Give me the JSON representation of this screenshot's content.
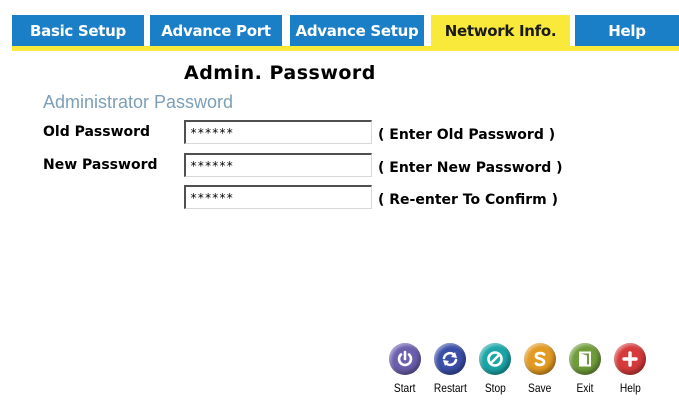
{
  "tabs": [
    {
      "label": "Basic Setup"
    },
    {
      "label": "Advance Port"
    },
    {
      "label": "Advance Setup"
    },
    {
      "label": "Network Info."
    },
    {
      "label": "Help"
    }
  ],
  "active_tab": "Network Info.",
  "page": {
    "title": "Admin. Password",
    "section_title": "Administrator Password"
  },
  "form": {
    "old_password": {
      "label": "Old Password",
      "value": "******",
      "hint": "( Enter Old Password )"
    },
    "new_password": {
      "label": "New Password",
      "value": "******",
      "hint": "( Enter New Password )"
    },
    "confirm_password": {
      "value": "******",
      "hint": "( Re-enter To Confirm )"
    }
  },
  "actions": [
    {
      "label": "Start",
      "icon": "power-icon",
      "color": "#6b5fae"
    },
    {
      "label": "Restart",
      "icon": "restart-icon",
      "color": "#3b4fa8"
    },
    {
      "label": "Stop",
      "icon": "stop-icon",
      "color": "#1aa5a8"
    },
    {
      "label": "Save",
      "icon": "save-icon",
      "color": "#e29a22"
    },
    {
      "label": "Exit",
      "icon": "exit-icon",
      "color": "#6f9b3a"
    },
    {
      "label": "Help",
      "icon": "plus-icon",
      "color": "#d63a3a"
    }
  ],
  "colors": {
    "tab_blue": "#1b7fc8",
    "tab_active": "#f8e93a",
    "section_title": "#7c9fb8"
  }
}
